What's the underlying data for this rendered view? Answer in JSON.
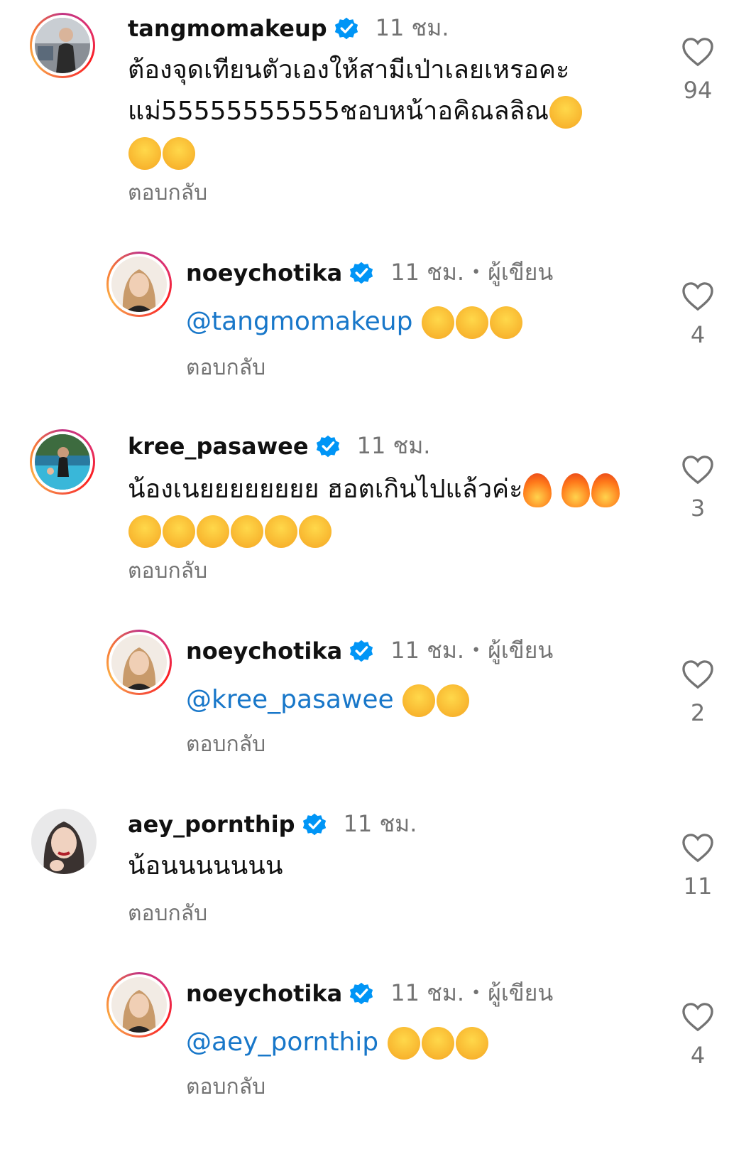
{
  "reply_label": "ตอบกลับ",
  "author_label": "ผู้เขียน",
  "colors": {
    "mention": "#00376b",
    "muted": "#737373",
    "verified": "#0095f6"
  },
  "comments": [
    {
      "username": "tangmomakeup",
      "time": "11 ชม.",
      "text": "ต้องจุดเทียนตัวเองให้สามีเป่าเลยเหรอคะแม่55555555555ชอบหน้าอคิณลลิณ",
      "emojis": [
        "laugh",
        "laugh",
        "laugh"
      ],
      "likes": "94"
    },
    {
      "username": "noeychotika",
      "time": "11 ชม.",
      "mention": "@tangmomakeup",
      "emojis": [
        "laugh",
        "laugh",
        "laugh"
      ],
      "likes": "4"
    },
    {
      "username": "kree_pasawee",
      "time": "11 ชม.",
      "text": "น้องเนยยยยยยยย ฮอตเกินไปแล้วค่ะ",
      "emojis": [
        "fire",
        "fire",
        "fire",
        "wow",
        "wow",
        "wow",
        "laugh",
        "laugh",
        "laugh"
      ],
      "likes": "3"
    },
    {
      "username": "noeychotika",
      "time": "11 ชม.",
      "mention": "@kree_pasawee",
      "emojis": [
        "plead",
        "rofl"
      ],
      "likes": "2"
    },
    {
      "username": "aey_pornthip",
      "time": "11 ชม.",
      "text": "น้อนนนนนนน",
      "likes": "11"
    },
    {
      "username": "noeychotika",
      "time": "11 ชม.",
      "mention": "@aey_pornthip",
      "emojis": [
        "plead",
        "sweat",
        "laugh"
      ],
      "likes": "4"
    }
  ]
}
